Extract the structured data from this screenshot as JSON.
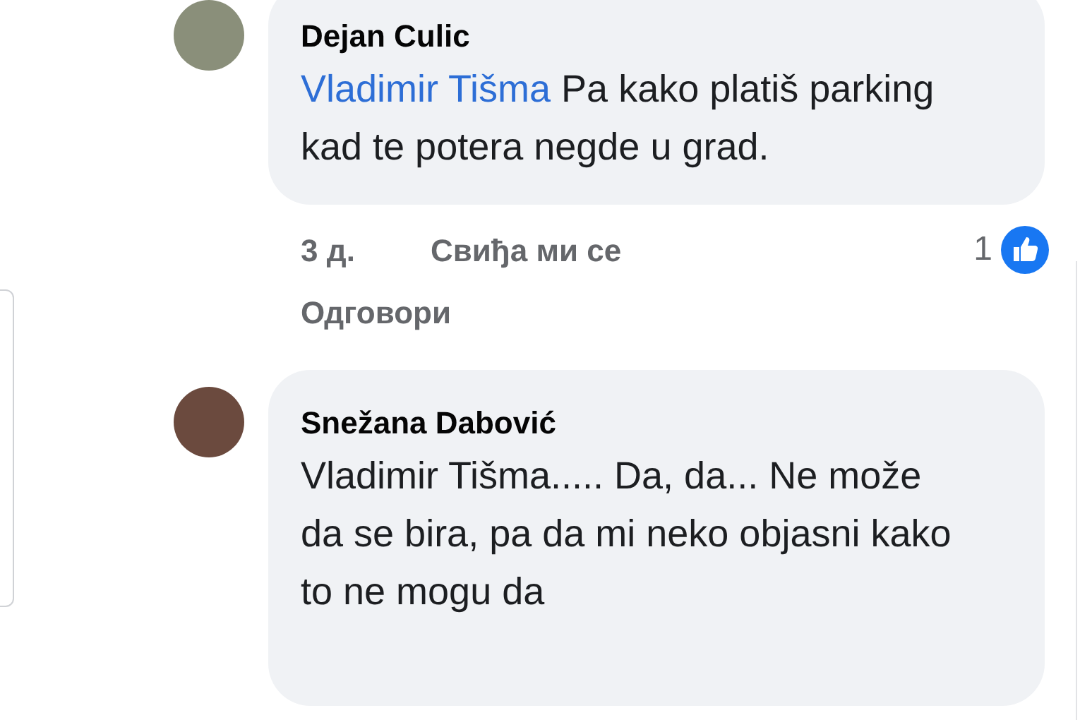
{
  "comments": [
    {
      "author": "Dejan Culic",
      "mention": "Vladimir Tišma",
      "text": "Pa kako platiš parking kad te potera negde u grad.",
      "time": "3 д.",
      "like_label": "Свиђа ми се",
      "reply_label": "Одговори",
      "reaction_count": "1"
    },
    {
      "author": "Snežana Dabović",
      "text": "Vladimir Tišma..... Da, da... Ne može da se bira, pa da mi neko objasni kako to ne mogu da"
    }
  ]
}
